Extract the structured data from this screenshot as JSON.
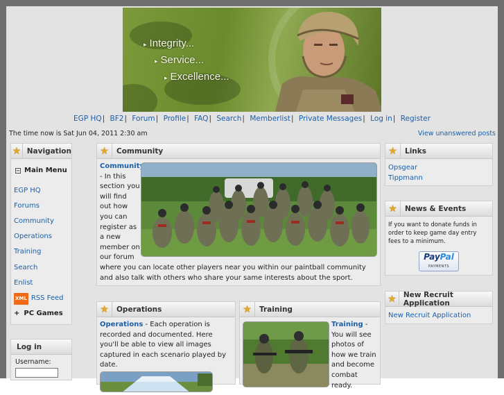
{
  "banner": {
    "slogans": [
      "Integrity...",
      "Service...",
      "Excellence..."
    ]
  },
  "topnav": {
    "items": [
      "EGP HQ",
      "BF2",
      "Forum",
      "Profile",
      "FAQ",
      "Search",
      "Memberlist",
      "Private Messages",
      "Log in",
      "Register"
    ]
  },
  "time_text": "The time now is Sat Jun 04, 2011 2:30 am",
  "unanswered_link": "View unanswered posts",
  "navigation": {
    "title": "Navigation",
    "main_menu": "Main Menu",
    "items": [
      "EGP HQ",
      "Forums",
      "Community",
      "Operations",
      "Training",
      "Search",
      "Enlist"
    ],
    "xml_badge": "XML",
    "rss": "RSS Feed",
    "pc_games": "PC Games"
  },
  "login": {
    "title": "Log in",
    "username_label": "Username:"
  },
  "community": {
    "title": "Community",
    "lead": "Community",
    "text_narrow": "- In this section you will find out how you can register as a new member on our forum",
    "text_wide": "where you can locate other players near you within our paintball community and also talk with others who share your same interests about the sport."
  },
  "operations": {
    "title": "Operations",
    "lead": "Operations",
    "text": " - Each operation is recorded and documented. Here you'll be able to view all images captured in each scenario played by date."
  },
  "training": {
    "title": "Training",
    "lead": "Training",
    "text": " - You will see photos of how we train and become combat ready."
  },
  "links": {
    "title": "Links",
    "items": [
      "Opsgear",
      "Tippmann"
    ]
  },
  "news": {
    "title": "News & Events",
    "text": "If you want to donate funds in order to keep game day entry fees to a minimum.",
    "paypal_a": "Pay",
    "paypal_b": "Pal",
    "paypal_sub": "PAYMENTS"
  },
  "recruit": {
    "title": "New Recruit Application",
    "link": "New Recruit Application"
  },
  "colors": {
    "link": "#1a5ea8",
    "frame": "#6f6f6f",
    "star": "#e0a92a"
  }
}
